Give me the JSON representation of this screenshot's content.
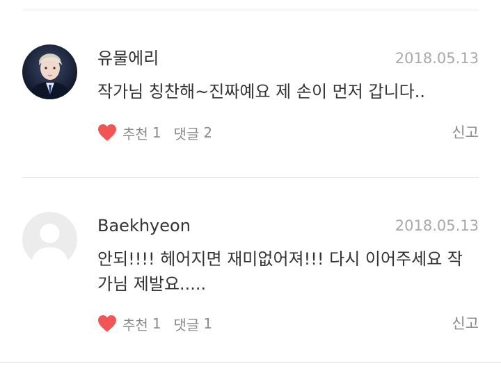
{
  "comments": [
    {
      "author": "유물에리",
      "date": "2018.05.13",
      "text": "작가님 칭찬해~진짜예요 제 손이 먼저 갑니다..",
      "recommend_label": "추천",
      "recommend_count": "1",
      "reply_label": "댓글",
      "reply_count": "2",
      "report_label": "신고",
      "avatar_icon": "profile-photo"
    },
    {
      "author": "Baekhyeon",
      "date": "2018.05.13",
      "text": "안되!!!! 헤어지면 재미없어져!!! 다시 이어주세요 작가님 제발요.....",
      "recommend_label": "추천",
      "recommend_count": "1",
      "reply_label": "댓글",
      "reply_count": "1",
      "report_label": "신고",
      "avatar_icon": "default-user-avatar"
    }
  ],
  "colors": {
    "heart": "#f25555",
    "text": "#333333",
    "muted": "#8a8a8a",
    "date": "#a9a9a9",
    "divider": "#e6e6e6"
  }
}
